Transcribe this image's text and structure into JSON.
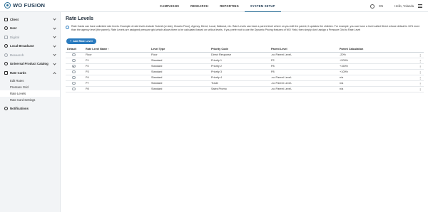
{
  "app": {
    "logo": "WO FUSION"
  },
  "topnav": [
    "CAMPAIGNS",
    "RESEARCH",
    "REPORTING",
    "SYSTEM SETUP"
  ],
  "topnav_active": "SYSTEM SETUP",
  "topright": {
    "language": "EN",
    "greeting": "Hello, Yolanda"
  },
  "sidebar": {
    "items": [
      {
        "label": "Client",
        "disabled": false,
        "chevron": "down"
      },
      {
        "label": "User",
        "disabled": false,
        "chevron": "down"
      },
      {
        "label": "Digital",
        "disabled": true,
        "chevron": "down"
      },
      {
        "label": "Local Broadcast",
        "disabled": false,
        "chevron": "down"
      },
      {
        "label": "Research",
        "disabled": true,
        "chevron": "down"
      },
      {
        "label": "Universal Product Catalog",
        "disabled": false,
        "chevron": "down"
      },
      {
        "label": "Rate Cards",
        "disabled": false,
        "chevron": "up"
      }
    ],
    "subitems": [
      "Edit Rates",
      "Pressure Grid",
      "Rate Levels",
      "Rate Card Settings"
    ],
    "active_subitem": "Rate Levels",
    "bottom_item": "Notifications"
  },
  "main": {
    "title": "Rate Levels",
    "info": "Rate Cards can have unlimited rate levels. Example of rate levels include Submit (or Ask), Closeto Floor), Agency, Direct, Local, National, etc. Rate Levels can have a parent level where on you edit the parent, it updates the children. For example, you can have a level called Direct whose default is 10% more than the agency level (the parent). Rate Levels are assigned pressure grid which allows them to be calculated based on sellout levels. If you prefer not to use the Dynamic Pricing features of WO Yield, then simply don't assign a Pressure Grid to Rate Level",
    "add_button": "Add Rate Level",
    "columns": [
      "Default",
      "Rate Level Name ↑",
      "Level Type",
      "Priority Code",
      "Parent Level",
      "Parent Calculation"
    ],
    "rows": [
      {
        "default": false,
        "name": "Floor",
        "type": "Floor",
        "priority": "Direct Response",
        "parent": "-no Parent Level-",
        "calc": "-20%"
      },
      {
        "default": false,
        "name": "P1",
        "type": "Standard",
        "priority": "Priority 1",
        "parent": "P2",
        "calc": "+200%"
      },
      {
        "default": true,
        "name": "P2",
        "type": "Standard",
        "priority": "Priority 2",
        "parent": "P8",
        "calc": "+150%"
      },
      {
        "default": false,
        "name": "P3",
        "type": "Standard",
        "priority": "Priority 3",
        "parent": "P8",
        "calc": "+100%"
      },
      {
        "default": false,
        "name": "P4",
        "type": "Standard",
        "priority": "Priority 4",
        "parent": "-no Parent Level-",
        "calc": "n/a"
      },
      {
        "default": false,
        "name": "P7",
        "type": "Standard",
        "priority": "Trade",
        "parent": "-no Parent Level-",
        "calc": "n/a"
      },
      {
        "default": false,
        "name": "P8",
        "type": "Standard",
        "priority": "Sales Promo",
        "parent": "-no Parent Level-",
        "calc": "n/a"
      }
    ]
  },
  "colors": {
    "accent": "#2a7bbf",
    "sidebar_bg": "#f2f4f6"
  },
  "icons": [
    "logo-icon",
    "globe-icon",
    "menu-icon",
    "info-icon",
    "plus-icon",
    "kebab-icon"
  ]
}
